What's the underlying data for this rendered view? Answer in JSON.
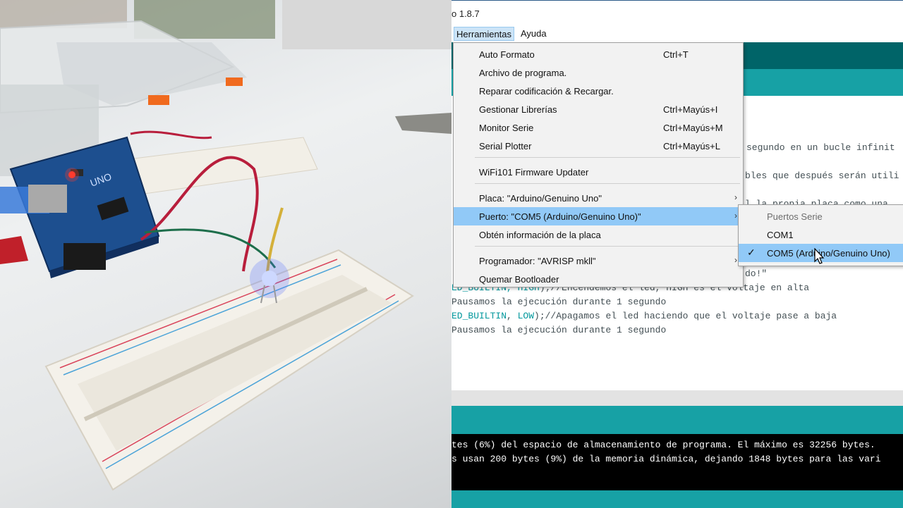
{
  "ide": {
    "title": "o 1.8.7",
    "menu": {
      "tools_label": "Herramientas",
      "help_label": "Ayuda"
    },
    "tools_menu": {
      "items": [
        {
          "label": "Auto Formato",
          "shortcut": "Ctrl+T"
        },
        {
          "label": "Archivo de programa.",
          "shortcut": ""
        },
        {
          "label": "Reparar codificación & Recargar.",
          "shortcut": ""
        },
        {
          "label": "Gestionar Librerías",
          "shortcut": "Ctrl+Mayús+I"
        },
        {
          "label": "Monitor Serie",
          "shortcut": "Ctrl+Mayús+M"
        },
        {
          "label": "Serial Plotter",
          "shortcut": "Ctrl+Mayús+L"
        },
        {
          "label": "WiFi101 Firmware Updater",
          "shortcut": ""
        },
        {
          "label": "Placa: \"Arduino/Genuino Uno\"",
          "shortcut": ""
        },
        {
          "label": "Puerto: \"COM5 (Arduino/Genuino Uno)\"",
          "shortcut": ""
        },
        {
          "label": "Obtén información de la placa",
          "shortcut": ""
        },
        {
          "label": "Programador: \"AVRISP mkll\"",
          "shortcut": ""
        },
        {
          "label": "Quemar Bootloader",
          "shortcut": ""
        }
      ]
    },
    "port_submenu": {
      "header": "Puertos Serie",
      "items": [
        {
          "label": "COM1",
          "checked": false
        },
        {
          "label": "COM5 (Arduino/Genuino Uno)",
          "checked": true
        }
      ]
    },
    "code": {
      "line1": "segundo en un bucle infinit",
      "line2": "bles que después serán utili",
      "line3": "l la propia placa como una",
      "line4": "do!\"",
      "line5_kw": "ED_BUILTIN, HIGH",
      "line5_rest": ");//Encendemos el led, HIGH es el voltaje en alta",
      "line6": "Pausamos la ejecución durante 1 segundo",
      "line7_kw1": "ED_BUILTIN",
      "line7_mid": ", ",
      "line7_kw2": "LOW",
      "line7_rest": ");//Apagamos el led haciendo que el voltaje pase a baja",
      "line8": "Pausamos la ejecución durante 1 segundo"
    },
    "console": {
      "line1": "tes (6%) del espacio de almacenamiento de programa. El máximo es 32256 bytes.",
      "line2": "s usan 200 bytes (9%) de la memoria dinámica, dejando 1848 bytes para las vari"
    },
    "colors": {
      "toolbar": "#006468",
      "tabbar": "#17a1a5",
      "highlight": "#91c9f7",
      "keyword": "#00979c"
    }
  },
  "photo": {
    "board_label": "UNO",
    "description_icon": "arduino-board-photo"
  }
}
